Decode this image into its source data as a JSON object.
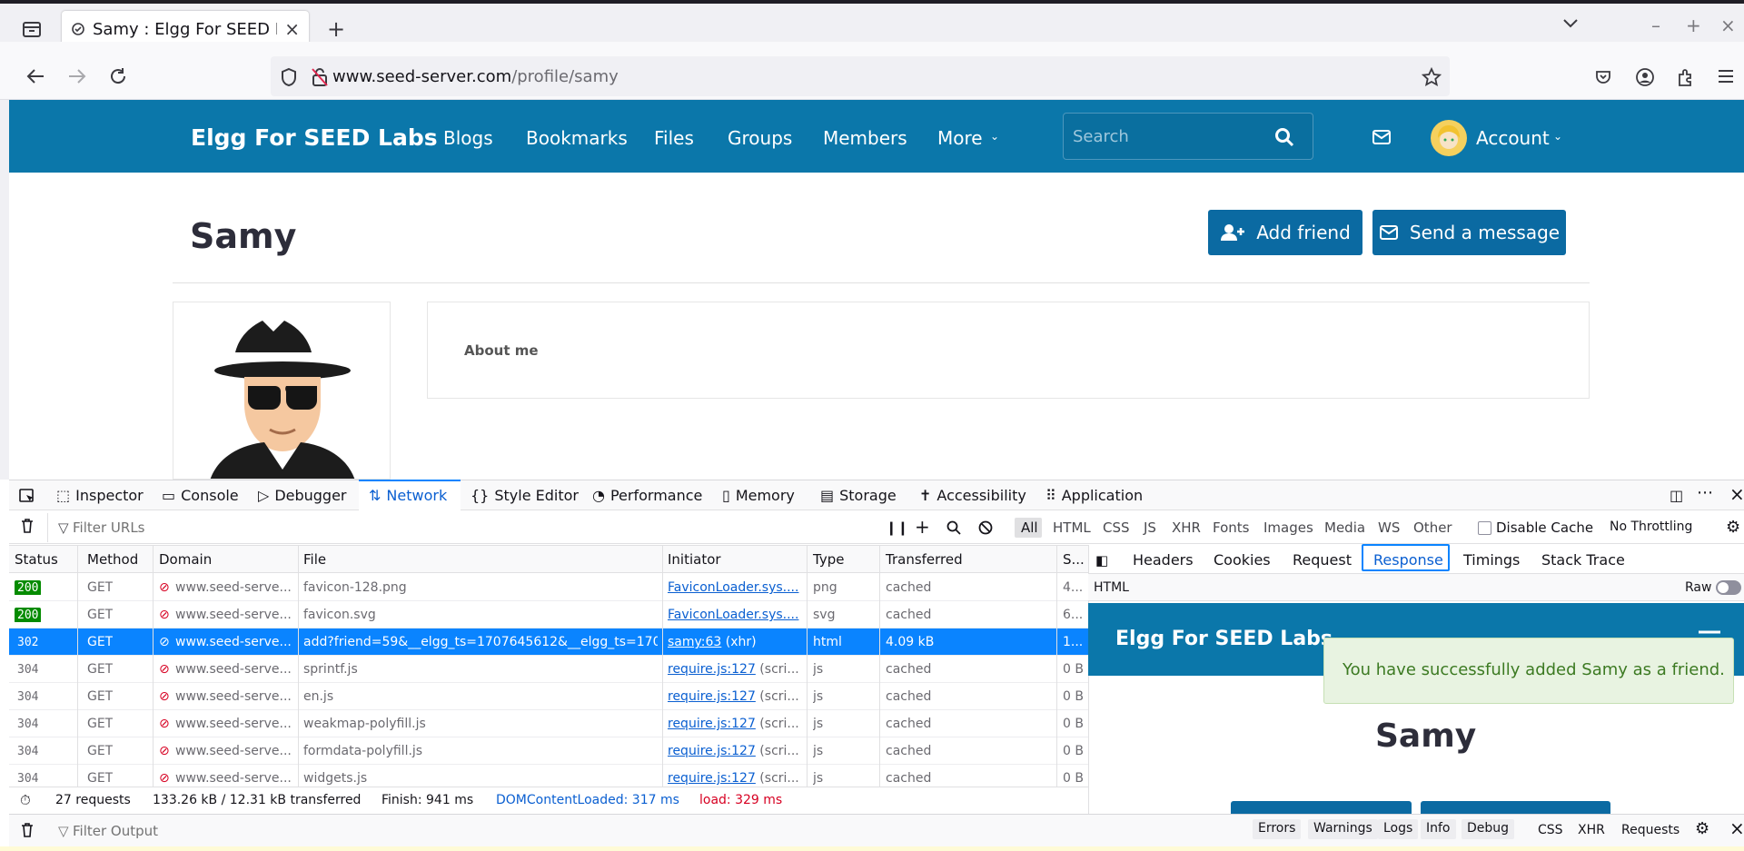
{
  "browser": {
    "tab_title": "Samy : Elgg For SEED Labs",
    "url_host": "www.seed-server.com",
    "url_path": "/profile/samy"
  },
  "site": {
    "brand": "Elgg For SEED Labs",
    "nav": [
      "Blogs",
      "Bookmarks",
      "Files",
      "Groups",
      "Members",
      "More"
    ],
    "search_placeholder": "Search",
    "account_label": "Account"
  },
  "profile": {
    "name": "Samy",
    "add_friend_label": "Add friend",
    "send_message_label": "Send a message",
    "about_label": "About me"
  },
  "devtools": {
    "tabs": [
      "Inspector",
      "Console",
      "Debugger",
      "Network",
      "Style Editor",
      "Performance",
      "Memory",
      "Storage",
      "Accessibility",
      "Application"
    ],
    "active_tab": "Network",
    "filter_placeholder": "Filter URLs",
    "type_filters": [
      "All",
      "HTML",
      "CSS",
      "JS",
      "XHR",
      "Fonts",
      "Images",
      "Media",
      "WS",
      "Other"
    ],
    "disable_cache_label": "Disable Cache",
    "throttling": "No Throttling",
    "columns": [
      "Status",
      "Method",
      "Domain",
      "File",
      "Initiator",
      "Type",
      "Transferred",
      "S..."
    ],
    "rows": [
      {
        "status": "200",
        "method": "GET",
        "domain": "www.seed-serve...",
        "file": "favicon-128.png",
        "initiator": "FaviconLoader.sys....",
        "initiator_extra": "",
        "type": "png",
        "transferred": "cached",
        "size": "4..."
      },
      {
        "status": "200",
        "method": "GET",
        "domain": "www.seed-serve...",
        "file": "favicon.svg",
        "initiator": "FaviconLoader.sys....",
        "initiator_extra": "",
        "type": "svg",
        "transferred": "cached",
        "size": "6..."
      },
      {
        "status": "302",
        "method": "GET",
        "domain": "www.seed-serve...",
        "file": "add?friend=59&__elgg_ts=1707645612&__elgg_ts=1707",
        "initiator": "samy:63",
        "initiator_extra": " (xhr)",
        "type": "html",
        "transferred": "4.09 kB",
        "size": "1..."
      },
      {
        "status": "304",
        "method": "GET",
        "domain": "www.seed-serve...",
        "file": "sprintf.js",
        "initiator": "require.js:127",
        "initiator_extra": " (scri...",
        "type": "js",
        "transferred": "cached",
        "size": "0 B"
      },
      {
        "status": "304",
        "method": "GET",
        "domain": "www.seed-serve...",
        "file": "en.js",
        "initiator": "require.js:127",
        "initiator_extra": " (scri...",
        "type": "js",
        "transferred": "cached",
        "size": "0 B"
      },
      {
        "status": "304",
        "method": "GET",
        "domain": "www.seed-serve...",
        "file": "weakmap-polyfill.js",
        "initiator": "require.js:127",
        "initiator_extra": " (scri...",
        "type": "js",
        "transferred": "cached",
        "size": "0 B"
      },
      {
        "status": "304",
        "method": "GET",
        "domain": "www.seed-serve...",
        "file": "formdata-polyfill.js",
        "initiator": "require.js:127",
        "initiator_extra": " (scri...",
        "type": "js",
        "transferred": "cached",
        "size": "0 B"
      },
      {
        "status": "304",
        "method": "GET",
        "domain": "www.seed-serve...",
        "file": "widgets.js",
        "initiator": "require.js:127",
        "initiator_extra": " (scri...",
        "type": "js",
        "transferred": "cached",
        "size": "0 B"
      }
    ],
    "summary": {
      "requests": "27 requests",
      "size": "133.26 kB / 12.31 kB transferred",
      "finish": "Finish: 941 ms",
      "dcl": "DOMContentLoaded: 317 ms",
      "load": "load: 329 ms"
    },
    "panel_tabs": [
      "Headers",
      "Cookies",
      "Request",
      "Response",
      "Timings",
      "Stack Trace"
    ],
    "active_panel_tab": "Response",
    "response_label": "HTML",
    "raw_label": "Raw",
    "preview": {
      "brand": "Elgg For SEED Labs",
      "message": "You have successfully added Samy as a friend.",
      "name": "Samy"
    },
    "console_filter": "Filter Output",
    "console_levels": [
      "Errors",
      "Warnings",
      "Logs",
      "Info",
      "Debug"
    ],
    "console_types": [
      "CSS",
      "XHR",
      "Requests"
    ]
  },
  "colors": {
    "brand": "#0b77aa",
    "selected": "#0a84ff",
    "success": "#058b00"
  }
}
